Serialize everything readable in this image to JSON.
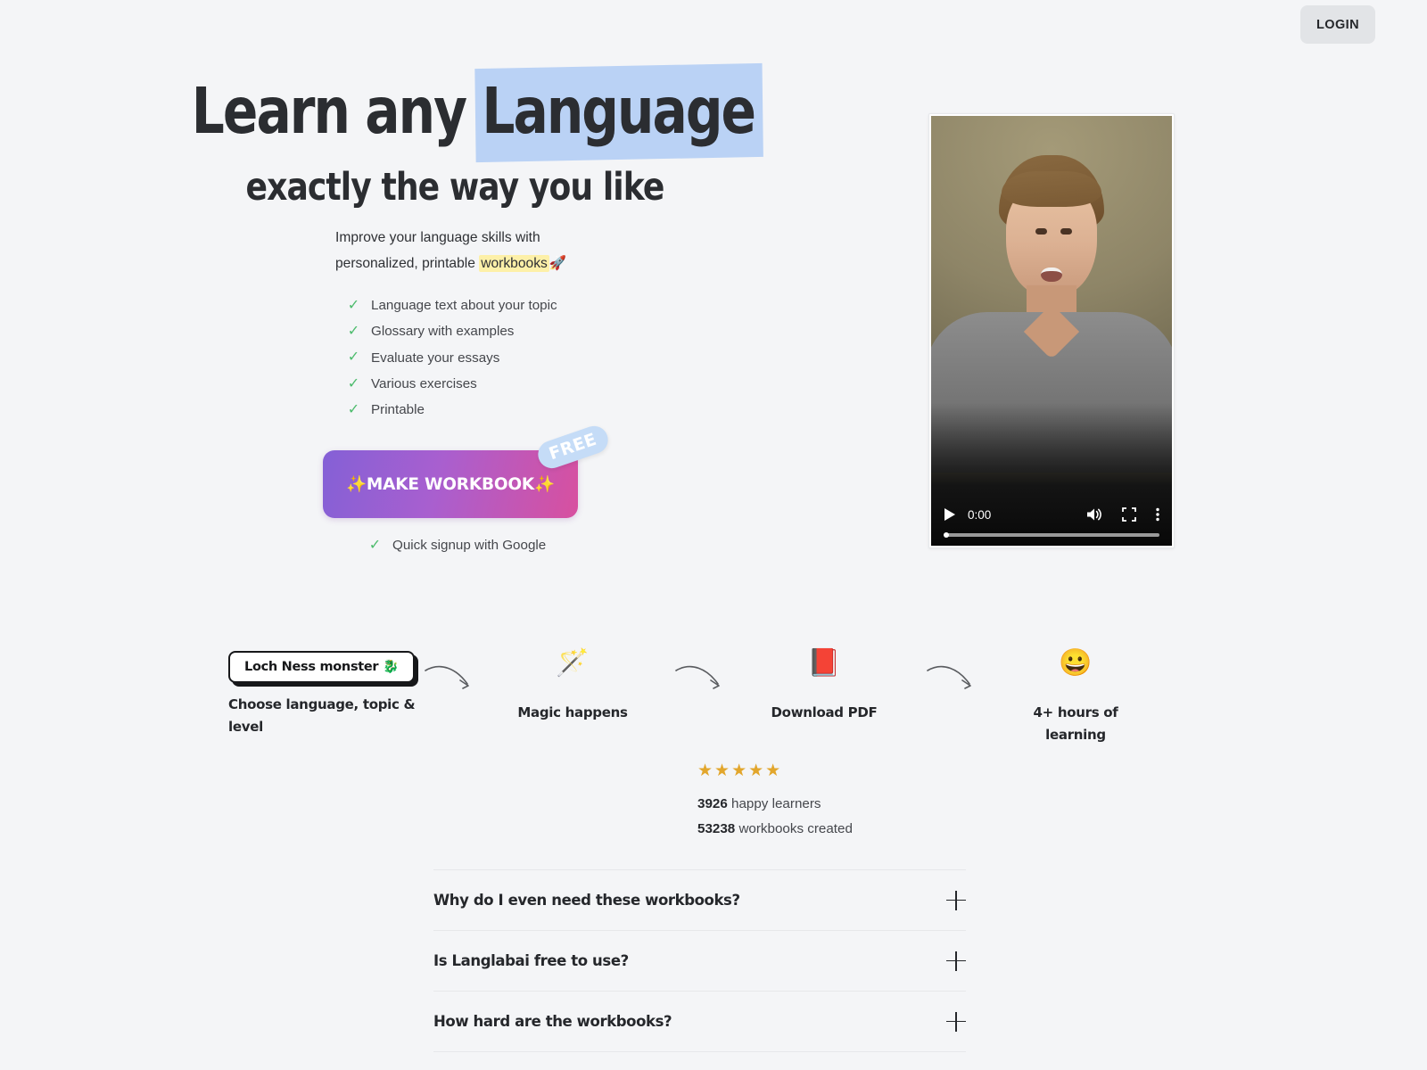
{
  "header": {
    "login_label": "LOGIN"
  },
  "hero": {
    "headline_pre": "Learn any ",
    "headline_highlight": "Language",
    "subheadline": "exactly the way you like",
    "lead_line1": "Improve your language skills with",
    "lead_line2_pre": "personalized, printable ",
    "lead_highlight": "workbooks",
    "lead_emoji": "🚀",
    "features": [
      "Language text about your topic",
      "Glossary with examples",
      "Evaluate your essays",
      "Various exercises",
      "Printable"
    ],
    "cta_label": "✨MAKE WORKBOOK✨",
    "cta_badge": "FREE",
    "cta_note": "Quick signup with Google",
    "check_glyph": "✓",
    "check_color": "#4cbb6c"
  },
  "video": {
    "play_icon": "play-icon",
    "time": "0:00",
    "volume_icon": "volume-icon",
    "fullscreen_icon": "fullscreen-icon",
    "more_icon": "more-options-icon"
  },
  "steps": [
    {
      "type": "pill",
      "pill_text": "Loch Ness monster 🐉",
      "caption": "Choose language, topic & level"
    },
    {
      "type": "emoji",
      "emoji": "🪄",
      "caption": "Magic happens"
    },
    {
      "type": "emoji",
      "emoji": "📕",
      "caption": "Download PDF"
    },
    {
      "type": "emoji",
      "emoji": "😀",
      "caption": "4+ hours of learning"
    }
  ],
  "rating": {
    "stars": "★★★★★",
    "star_count": 5,
    "star_color": "#e2a62c",
    "learners_count": "3926",
    "learners_label": " happy learners",
    "workbooks_count": "53238",
    "workbooks_label": " workbooks created"
  },
  "faq": {
    "items": [
      {
        "question": "Why do I even need these workbooks?"
      },
      {
        "question": "Is Langlabai free to use?"
      },
      {
        "question": "How hard are the workbooks?"
      }
    ]
  },
  "theme": {
    "bg": "#f4f5f7",
    "highlight_blue": "#bad2f5",
    "highlight_yellow": "#fdf0a8",
    "cta_from": "#8460d6",
    "cta_to": "#d8509f"
  }
}
